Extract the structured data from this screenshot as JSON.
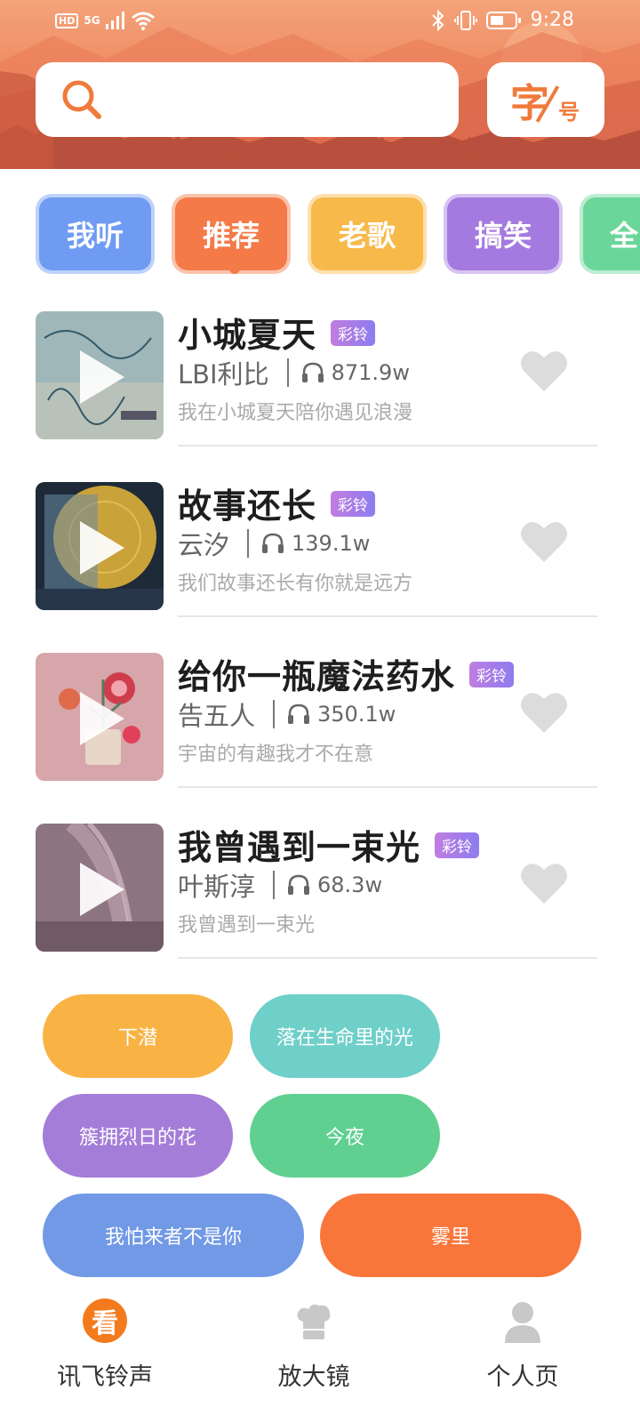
{
  "status_bar": {
    "left_badge": "HD",
    "network": "5G",
    "time": "9:28"
  },
  "search": {
    "placeholder": ""
  },
  "font_size_button": {
    "big": "字",
    "small": "号"
  },
  "tabs": [
    {
      "label": "我听",
      "color": "#6f9bf2"
    },
    {
      "label": "推荐",
      "color": "#f47a48"
    },
    {
      "label": "老歌",
      "color": "#f8b94b"
    },
    {
      "label": "搞笑",
      "color": "#a57ae0"
    },
    {
      "label": "全",
      "color": "#6bd69a"
    }
  ],
  "ringtone_badge": "彩铃",
  "songs": [
    {
      "title": "小城夏天",
      "artist": "LBI利比",
      "plays": "871.9w",
      "desc": "我在小城夏天陪你遇见浪漫"
    },
    {
      "title": "故事还长",
      "artist": "云汐",
      "plays": "139.1w",
      "desc": "我们故事还长有你就是远方"
    },
    {
      "title": "给你一瓶魔法药水",
      "artist": "告五人",
      "plays": "350.1w",
      "desc": "宇宙的有趣我才不在意"
    },
    {
      "title": "我曾遇到一束光",
      "artist": "叶斯淳",
      "plays": "68.3w",
      "desc": "我曾遇到一束光"
    }
  ],
  "tags": [
    {
      "label": "下潜",
      "color": "#f9b344"
    },
    {
      "label": "落在生命里的光",
      "color": "#6fcfc9"
    },
    {
      "label": "簇拥烈日的花",
      "color": "#a47dd9"
    },
    {
      "label": "今夜",
      "color": "#5fd08f"
    },
    {
      "label": "我怕来者不是你",
      "color": "#7199e6"
    },
    {
      "label": "雾里",
      "color": "#f9763a"
    }
  ],
  "nav": {
    "home_icon_text": "看",
    "items": [
      {
        "label": "讯飞铃声"
      },
      {
        "label": "放大镜"
      },
      {
        "label": "个人页"
      }
    ]
  },
  "colors": {
    "accent": "#f47a48",
    "heart": "#dcdcdc"
  }
}
